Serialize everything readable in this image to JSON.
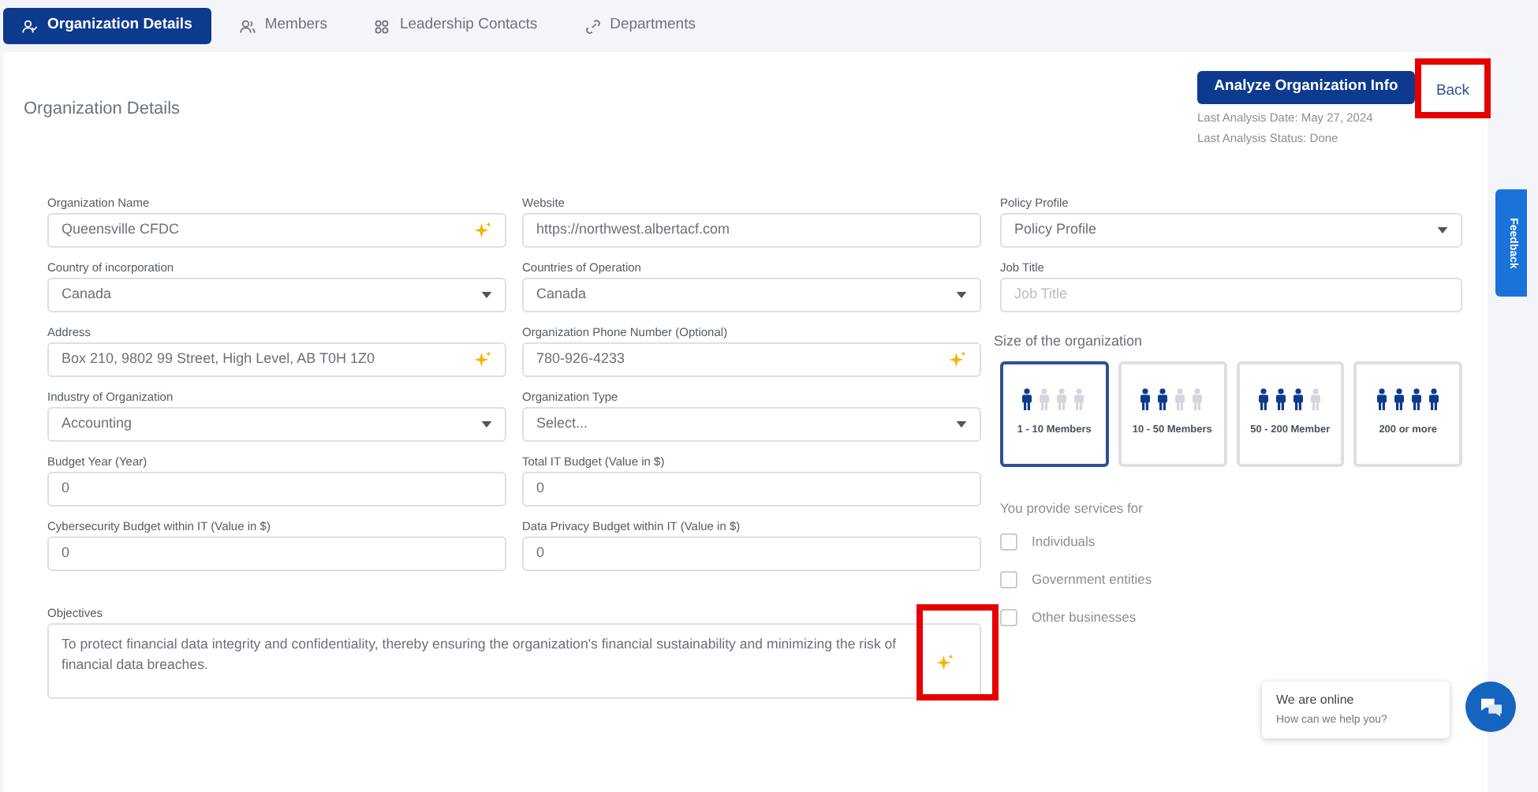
{
  "tabs": [
    {
      "label": "Organization Details",
      "selected": true
    },
    {
      "label": "Members",
      "selected": false
    },
    {
      "label": "Leadership Contacts",
      "selected": false
    },
    {
      "label": "Departments",
      "selected": false
    }
  ],
  "page_title": "Organization Details",
  "analyze_button": "Analyze Organization Info",
  "back_button": {
    "label": "Back",
    "highlighted": true
  },
  "analysis_info": [
    "Last Analysis Date: May 27, 2024",
    "Last Analysis Status: Done"
  ],
  "fields": [
    {
      "label": "Organization Name",
      "kind": "ai-text",
      "value": "Queensville CFDC"
    },
    {
      "label": "Website",
      "kind": "text",
      "value": "https://northwest.albertacf.com"
    },
    {
      "label": "Country of incorporation",
      "kind": "select",
      "value": "Canada"
    },
    {
      "label": "Countries of Operation",
      "kind": "select",
      "value": "Canada"
    },
    {
      "label": "Address",
      "kind": "ai-text",
      "value": "Box 210, 9802 99 Street, High Level, AB T0H 1Z0"
    },
    {
      "label": "Organization Phone Number (Optional)",
      "kind": "ai-text",
      "value": "780-926-4233"
    },
    {
      "label": "Industry of Organization",
      "kind": "select",
      "value": "Accounting"
    },
    {
      "label": "Organization Type",
      "kind": "select",
      "value": "Select..."
    },
    {
      "label": "Budget Year (Year)",
      "kind": "text",
      "value": "0"
    },
    {
      "label": "Total IT Budget (Value in $)",
      "kind": "text",
      "value": "0"
    },
    {
      "label": "Cybersecurity Budget within IT (Value in $)",
      "kind": "text",
      "value": "0"
    },
    {
      "label": "Data Privacy Budget within IT (Value in $)",
      "kind": "text",
      "value": "0"
    }
  ],
  "objectives": {
    "label": "Objectives",
    "value": "To protect financial data integrity and confidentiality, thereby ensuring the organization's financial sustainability and minimizing the risk of financial data breaches.",
    "highlighted": true
  },
  "right_fields": [
    {
      "label": "Policy Profile",
      "kind": "select",
      "value": "Policy Profile"
    },
    {
      "label": "Job Title",
      "kind": "text",
      "placeholder": "Job Title"
    }
  ],
  "size_title": "Size of the organization",
  "size_options": [
    {
      "label": "1 - 10 Members",
      "selected": true
    },
    {
      "label": "10 - 50 Members",
      "selected": false
    },
    {
      "label": "50 - 200 Member",
      "selected": false
    },
    {
      "label": "200 or more",
      "selected": false
    }
  ],
  "services_title": "You provide services for",
  "services": [
    {
      "label": "Individuals",
      "checked": false
    },
    {
      "label": "Government entities",
      "checked": false
    },
    {
      "label": "Other businesses",
      "checked": false
    }
  ],
  "feedback_tab": "Feedback",
  "chat": {
    "title": "We are online",
    "subtitle": "How can we help you?"
  }
}
